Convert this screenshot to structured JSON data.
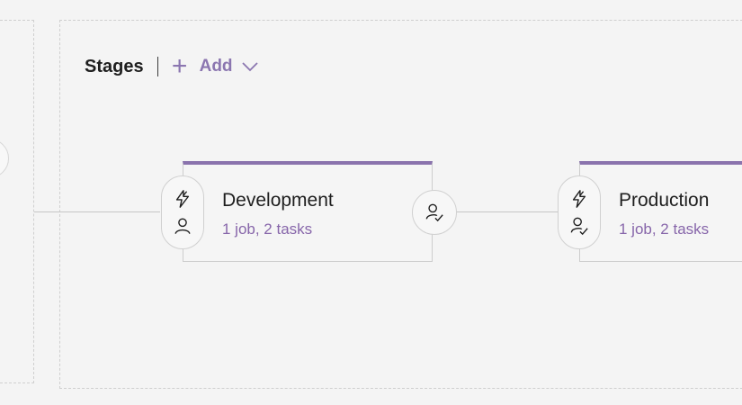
{
  "stages": {
    "title": "Stages",
    "add_label": "Add",
    "add_icon": "plus-icon",
    "chevron_icon": "chevron-down-icon",
    "items": [
      {
        "name": "Development",
        "summary": "1 job, 2 tasks",
        "pre_icons": [
          "lightning-icon",
          "person-icon"
        ],
        "post_icon": "person-check-icon",
        "accent": "#8a73ad"
      },
      {
        "name": "Production",
        "summary": "1 job, 2 tasks",
        "pre_icons": [
          "lightning-icon",
          "person-check-icon"
        ],
        "accent": "#8a73ad"
      }
    ]
  },
  "colors": {
    "accent": "#8a73ad",
    "summary_text": "#8766aa",
    "background": "#f4f4f4"
  }
}
